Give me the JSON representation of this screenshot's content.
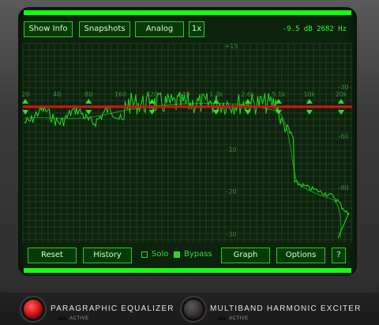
{
  "toolbar": {
    "show_info": "Show Info",
    "snapshots": "Snapshots",
    "analog": "Analog",
    "zoom": "1x"
  },
  "readout": "-9.5 dB 2682 Hz",
  "graph": {
    "freq_labels": [
      "20",
      "40",
      "80",
      "160",
      "320",
      "640",
      "1.3k",
      "2.6k",
      "5.1k",
      "10k",
      "20k"
    ],
    "freq_marks_hz": [
      20,
      40,
      80,
      160,
      320,
      640,
      1300,
      2600,
      5100,
      10000,
      20000
    ],
    "db_labels": [
      "+15",
      "-30",
      "-60",
      "-90",
      "-10",
      "-20",
      "-30"
    ],
    "eq_line_color": "#e01010",
    "spectrum_color": "#22dd22",
    "grid_color": "#3f6a3f",
    "background_color": "#0d220d",
    "band_handles_hz": [
      20,
      80,
      320,
      1300,
      2600,
      5100,
      10000,
      20000
    ]
  },
  "bottom": {
    "reset": "Reset",
    "history": "History",
    "solo": "Solo",
    "bypass": "Bypass",
    "graph": "Graph",
    "options": "Options",
    "help": "?"
  },
  "plugins": [
    {
      "name": "PARAGRAPHIC EQUALIZER",
      "status": "ACTIVE",
      "power_color": "#d81818"
    },
    {
      "name": "MULTIBAND HARMONIC EXCITER",
      "status": "ACTIVE",
      "power_color": "#3a3a3a"
    }
  ]
}
